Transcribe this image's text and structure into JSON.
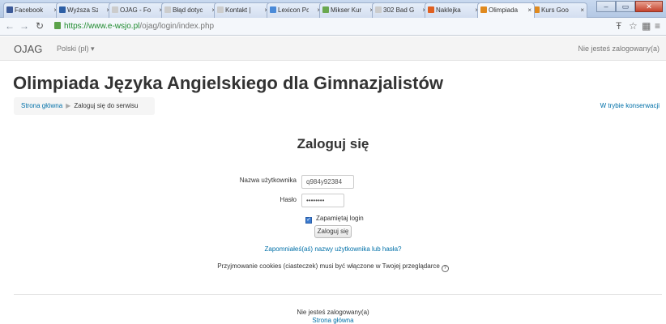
{
  "browser": {
    "tabs": [
      {
        "label": "Facebook",
        "favicon_color": "#3b5998"
      },
      {
        "label": "Wyższa Sz",
        "favicon_color": "#2d5fa5"
      },
      {
        "label": "OJAG - Fo",
        "favicon_color": "#cccccc"
      },
      {
        "label": "Błąd dotyc",
        "favicon_color": "#cccccc"
      },
      {
        "label": "Kontakt | ",
        "favicon_color": "#cccccc"
      },
      {
        "label": "Lexicon Pc",
        "favicon_color": "#4a8ad8"
      },
      {
        "label": "Mikser Kur",
        "favicon_color": "#6aa84f"
      },
      {
        "label": "302 Bad Ga",
        "favicon_color": "#cccccc"
      },
      {
        "label": "Naklejka ",
        "favicon_color": "#e06020"
      },
      {
        "label": "Olimpiada",
        "favicon_color": "#e08a1e",
        "active": true
      },
      {
        "label": "Kurs Goo",
        "favicon_color": "#e08a1e"
      }
    ],
    "url_secure": "https://www.e-wsjo.pl",
    "url_path": "/ojag/login/index.php",
    "window_controls": {
      "minimize": "–",
      "maximize": "▭",
      "close": "✕"
    }
  },
  "nav": {
    "brand": "OJAG",
    "language": "Polski (pl) ▾",
    "login_status": "Nie jesteś zalogowany(a)"
  },
  "page": {
    "title": "Olimpiada Języka Angielskiego dla Gimnazjalistów",
    "breadcrumb": {
      "home": "Strona główna",
      "separator": "▶",
      "current": "Zaloguj się do serwisu"
    },
    "maintenance": "W trybie konserwacji"
  },
  "login": {
    "heading": "Zaloguj się",
    "username_label": "Nazwa użytkownika",
    "username_value": "q984y92384",
    "password_label": "Hasło",
    "password_value": "••••••••",
    "remember_label": "Zapamiętaj login",
    "remember_checked": true,
    "submit": "Zaloguj się",
    "forgot": "Zapomniałeś(aś) nazwy użytkownika lub hasła?",
    "cookies_notice": "Przyjmowanie cookies (ciasteczek) musi być włączone w Twojej przeglądarce",
    "help_icon": "?"
  },
  "footer": {
    "login_info": "Nie jesteś zalogowany(a)",
    "home_link": "Strona główna"
  }
}
